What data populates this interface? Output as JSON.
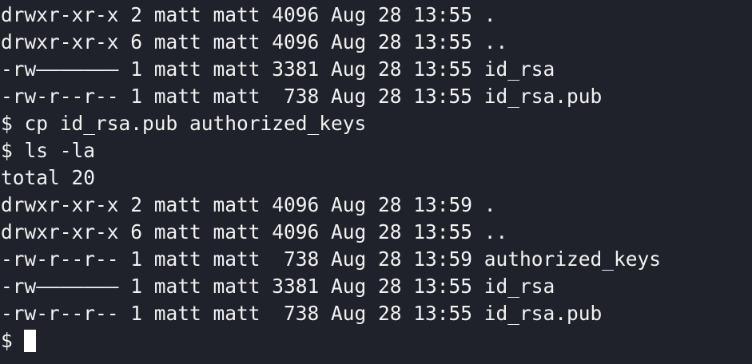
{
  "terminal": {
    "lines": [
      "drwxr-xr-x 2 matt matt 4096 Aug 28 13:55 .",
      "drwxr-xr-x 6 matt matt 4096 Aug 28 13:55 ..",
      "-rw——————— 1 matt matt 3381 Aug 28 13:55 id_rsa",
      "-rw-r--r-- 1 matt matt  738 Aug 28 13:55 id_rsa.pub",
      "$ cp id_rsa.pub authorized_keys",
      "$ ls -la",
      "total 20",
      "drwxr-xr-x 2 matt matt 4096 Aug 28 13:59 .",
      "drwxr-xr-x 6 matt matt 4096 Aug 28 13:55 ..",
      "-rw-r--r-- 1 matt matt  738 Aug 28 13:59 authorized_keys",
      "-rw——————— 1 matt matt 3381 Aug 28 13:55 id_rsa",
      "-rw-r--r-- 1 matt matt  738 Aug 28 13:55 id_rsa.pub"
    ],
    "prompt": "$"
  },
  "colors": {
    "background": "#1f222b",
    "foreground": "#f2f2f2",
    "cursor": "#ffffff"
  }
}
